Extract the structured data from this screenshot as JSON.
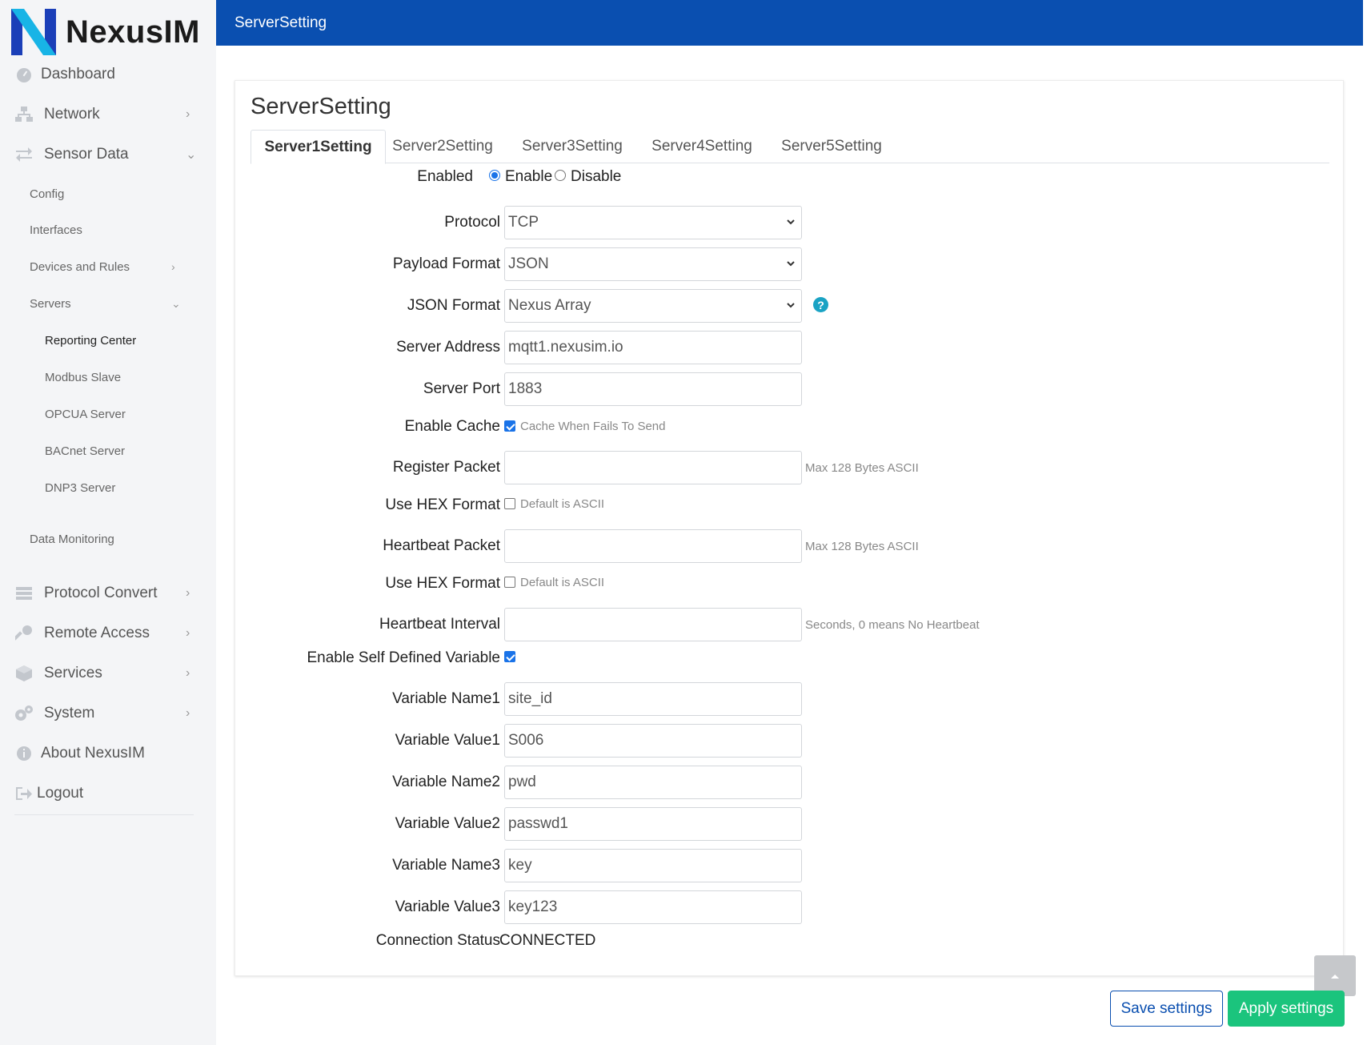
{
  "brand": {
    "name": "NexusIM"
  },
  "sidebar": {
    "items": [
      {
        "label": "Dashboard",
        "icon": "dashboard-icon"
      },
      {
        "label": "Network",
        "icon": "network-icon"
      },
      {
        "label": "Sensor Data",
        "icon": "exchange-icon"
      },
      {
        "label": "Config"
      },
      {
        "label": "Interfaces"
      },
      {
        "label": "Devices and Rules"
      },
      {
        "label": "Servers"
      },
      {
        "label": "Reporting Center"
      },
      {
        "label": "Modbus Slave"
      },
      {
        "label": "OPCUA Server"
      },
      {
        "label": "BACnet Server"
      },
      {
        "label": "DNP3 Server"
      },
      {
        "label": "Data Monitoring"
      },
      {
        "label": "Protocol Convert",
        "icon": "list-icon"
      },
      {
        "label": "Remote Access",
        "icon": "key-icon"
      },
      {
        "label": "Services",
        "icon": "cube-icon"
      },
      {
        "label": "System",
        "icon": "gears-icon"
      },
      {
        "label": "About NexusIM",
        "icon": "info-icon"
      },
      {
        "label": "Logout",
        "icon": "logout-icon"
      }
    ]
  },
  "header": {
    "title": "ServerSetting"
  },
  "card": {
    "title": "ServerSetting"
  },
  "tabs": [
    {
      "label": "Server1Setting",
      "active": true
    },
    {
      "label": "Server2Setting"
    },
    {
      "label": "Server3Setting"
    },
    {
      "label": "Server4Setting"
    },
    {
      "label": "Server5Setting"
    }
  ],
  "form": {
    "enabled": {
      "label": "Enabled",
      "enable": "Enable",
      "disable": "Disable",
      "value": "Enable"
    },
    "protocol": {
      "label": "Protocol",
      "value": "TCP"
    },
    "payload_format": {
      "label": "Payload Format",
      "value": "JSON"
    },
    "json_format": {
      "label": "JSON Format",
      "value": "Nexus Array"
    },
    "server_address": {
      "label": "Server Address",
      "value": "mqtt1.nexusim.io"
    },
    "server_port": {
      "label": "Server Port",
      "value": "1883"
    },
    "enable_cache": {
      "label": "Enable Cache",
      "checkbox_label": "Cache When Fails To Send",
      "checked": true
    },
    "register_packet": {
      "label": "Register Packet",
      "value": "",
      "hint": "Max 128 Bytes ASCII"
    },
    "register_hex": {
      "label": "Use HEX Format",
      "checkbox_label": "Default is ASCII",
      "checked": false
    },
    "heartbeat_packet": {
      "label": "Heartbeat Packet",
      "value": "",
      "hint": "Max 128 Bytes ASCII"
    },
    "heartbeat_hex": {
      "label": "Use HEX Format",
      "checkbox_label": "Default is ASCII",
      "checked": false
    },
    "heartbeat_interval": {
      "label": "Heartbeat Interval",
      "value": "",
      "hint": "Seconds, 0 means No Heartbeat"
    },
    "self_defined": {
      "label": "Enable Self Defined Variable",
      "checked": true
    },
    "variable_name1": {
      "label": "Variable Name1",
      "value": "site_id"
    },
    "variable_value1": {
      "label": "Variable Value1",
      "value": "S006"
    },
    "variable_name2": {
      "label": "Variable Name2",
      "value": "pwd"
    },
    "variable_value2": {
      "label": "Variable Value2",
      "value": "passwd1"
    },
    "variable_name3": {
      "label": "Variable Name3",
      "value": "key"
    },
    "variable_value3": {
      "label": "Variable Value3",
      "value": "key123"
    },
    "connection_status": {
      "label": "Connection Status",
      "value": "CONNECTED"
    }
  },
  "actions": {
    "save": "Save settings",
    "apply": "Apply settings"
  },
  "colors": {
    "header": "#0a4fb0",
    "apply": "#1bc47d",
    "sidebar_bg": "#f4f5f7",
    "help": "#1aa3c4"
  }
}
